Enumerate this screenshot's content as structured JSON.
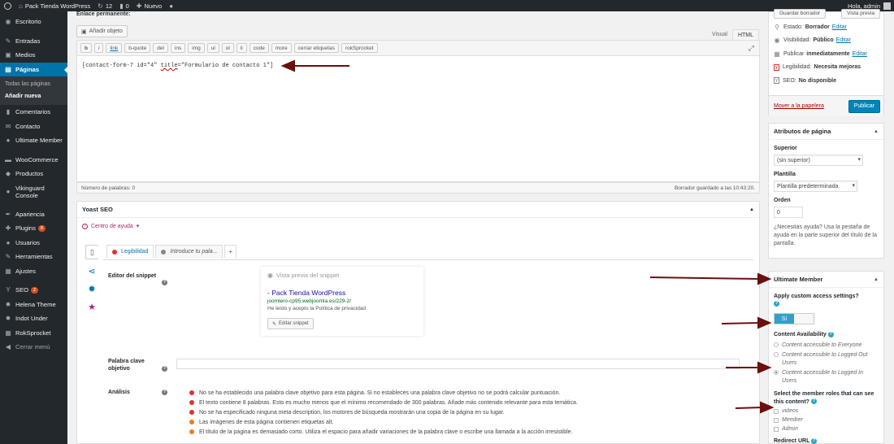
{
  "adminbar": {
    "site_name": "Pack Tienda WordPress",
    "updates": "12",
    "comments": "0",
    "new": "Nuevo",
    "greeting": "Hola, admin"
  },
  "sidebar": {
    "items": [
      {
        "label": "Escritorio",
        "icon": "dashboard-icon",
        "glyph": "◉"
      },
      {
        "label": "Entradas",
        "icon": "pin-icon",
        "glyph": "✎"
      },
      {
        "label": "Medios",
        "icon": "media-icon",
        "glyph": "▣"
      },
      {
        "label": "Páginas",
        "icon": "pages-icon",
        "glyph": "▤"
      },
      {
        "label": "Comentarios",
        "icon": "comments-icon",
        "glyph": "▮"
      },
      {
        "label": "Contacto",
        "icon": "mail-icon",
        "glyph": "✉"
      },
      {
        "label": "Ultimate Member",
        "icon": "user-icon",
        "glyph": "●"
      },
      {
        "label": "WooCommerce",
        "icon": "woocommerce-icon",
        "glyph": "▬"
      },
      {
        "label": "Productos",
        "icon": "products-icon",
        "glyph": "◆"
      },
      {
        "label": "Vikinguard Console",
        "icon": "shield-icon",
        "glyph": "●"
      },
      {
        "label": "Apariencia",
        "icon": "brush-icon",
        "glyph": "✒"
      },
      {
        "label": "Plugins",
        "icon": "plugin-icon",
        "glyph": "✚",
        "badge": "8"
      },
      {
        "label": "Usuarios",
        "icon": "users-icon",
        "glyph": "●"
      },
      {
        "label": "Herramientas",
        "icon": "tools-icon",
        "glyph": "✎"
      },
      {
        "label": "Ajustes",
        "icon": "settings-icon",
        "glyph": "▦"
      },
      {
        "label": "SEO",
        "icon": "yoast-icon",
        "glyph": "Y",
        "badge": "2"
      },
      {
        "label": "Helena Theme",
        "icon": "gear-icon",
        "glyph": "✹"
      },
      {
        "label": "Indot Under",
        "icon": "gear-icon",
        "glyph": "✹"
      },
      {
        "label": "RokSprocket",
        "icon": "rocket-icon",
        "glyph": "▦"
      },
      {
        "label": "Cerrar menú",
        "icon": "collapse-icon",
        "glyph": "◀"
      }
    ],
    "submenu": [
      "Todas las páginas",
      "Añadir nueva"
    ]
  },
  "editor": {
    "permalink_label": "Enlace permanente:",
    "add_media": "Añadir objeto",
    "tab_visual": "Visual",
    "tab_html": "HTML",
    "quicktags": [
      "b",
      "i",
      "link",
      "b-quote",
      "del",
      "ins",
      "img",
      "ul",
      "ol",
      "li",
      "code",
      "more",
      "cerrar etiquetas",
      "rokSprocket"
    ],
    "content_pre": "[contact-form-7 id=\"4\" ",
    "content_title": "title",
    "content_post": "=\"Formulario de contacto 1\"]",
    "word_count": "Número de palabras: 0",
    "draft_saved": "Borrador guardado a las 10:43:20."
  },
  "yoast": {
    "title": "Yoast SEO",
    "help": "Centro de ayuda",
    "tab_readability": "Legibilidad",
    "tab_keyword": "Introduce tu pala...",
    "tab_add": "+",
    "snippet_label": "Editor del snippet",
    "snippet_preview": "Vista previa del snippet",
    "snippet_title": "- Pack Tienda WordPress",
    "snippet_url": "joomlero-cp95.webjoomla.es/229-2/",
    "snippet_desc": "He leído y acepto la Política de privacidad",
    "snippet_button": "Editar snippet",
    "keyword_label": "Palabra clave objetivo",
    "analysis_label": "Análisis",
    "analysis": [
      {
        "text": "No se ha establecido una palabra clave objetivo para esta página. Si no estableces una palabra clave objetivo no se podrá calcular puntuación.",
        "color": "#dc3232"
      },
      {
        "text": "El texto contiene 8 palabras. Esto es mucho menos que el mínimo recomendado de 300 palabras. Añade más contenido relevante para esta temática.",
        "color": "#dc3232"
      },
      {
        "text": "No se ha especificado ninguna meta description, los motores de búsqueda mostrarán una copia de la página en su lugar.",
        "color": "#dc3232"
      },
      {
        "text": "Las imágenes de esta página contienen etiquetas alt.",
        "color": "#ee7c1b"
      },
      {
        "text": "El título de la página es demasiado corto. Utiliza el espacio para añadir variaciones de la palabra clave o escribe una llamada a la acción irresistible.",
        "color": "#ee7c1b"
      }
    ]
  },
  "publish": {
    "save_draft": "Guardar borrador",
    "preview": "Vista previa",
    "status_label": "Estado:",
    "status_value": "Borrador",
    "visibility_label": "Visibilidad:",
    "visibility_value": "Público",
    "publish_label": "Publicar",
    "publish_value": "inmediatamente",
    "readability_label": "Legibilidad:",
    "readability_value": "Necesita mejoras",
    "seo_label": "SEO:",
    "seo_value": "No disponible",
    "edit": "Editar",
    "trash": "Mover a la papelera",
    "publish_button": "Publicar"
  },
  "attributes": {
    "title": "Atributos de página",
    "parent_label": "Superior",
    "parent_value": "(sin superior)",
    "template_label": "Plantilla",
    "template_value": "Plantilla predeterminada",
    "order_label": "Orden",
    "order_value": "0",
    "help": "¿Necesitas ayuda? Usa la pestaña de ayuda en la parte superior del título de la pantalla."
  },
  "ultimate_member": {
    "title": "Ultimate Member",
    "custom_access_label": "Apply custom access settings?",
    "switch_on": "Sí",
    "availability_label": "Content Availability",
    "availability_options": [
      "Content accessible to Everyone",
      "Content accessible to Logged Out Users",
      "Content accessible to Logged In Users"
    ],
    "availability_selected": 2,
    "roles_label": "Select the member roles that can see this content?",
    "roles": [
      "videos",
      "Member",
      "Admin"
    ],
    "redirect_label": "Redirect URL"
  },
  "colors": {
    "admin_dark": "#23282d",
    "accent_blue": "#0073aa",
    "yoast_purple": "#a4286a",
    "arrow": "#6b0f0f"
  }
}
